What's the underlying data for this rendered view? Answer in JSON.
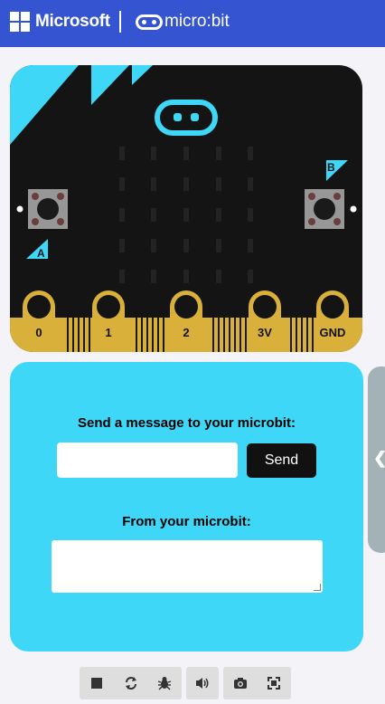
{
  "header": {
    "brand": "Microsoft",
    "product": "micro:bit"
  },
  "board": {
    "button_a": "A",
    "button_b": "B",
    "pins": [
      "0",
      "1",
      "2",
      "3V",
      "GND"
    ]
  },
  "panel": {
    "send_label": "Send a message to your microbit:",
    "send_input_value": "",
    "send_button": "Send",
    "receive_label": "From your microbit:",
    "receive_value": ""
  },
  "toolbar": {
    "icons": [
      "stop-icon",
      "restart-icon",
      "debug-icon",
      "volume-icon",
      "screenshot-icon",
      "fullscreen-icon"
    ]
  },
  "colors": {
    "header": "#3454d1",
    "accent": "#3fd7f7",
    "gold": "#d9b03a",
    "board": "#141414"
  }
}
